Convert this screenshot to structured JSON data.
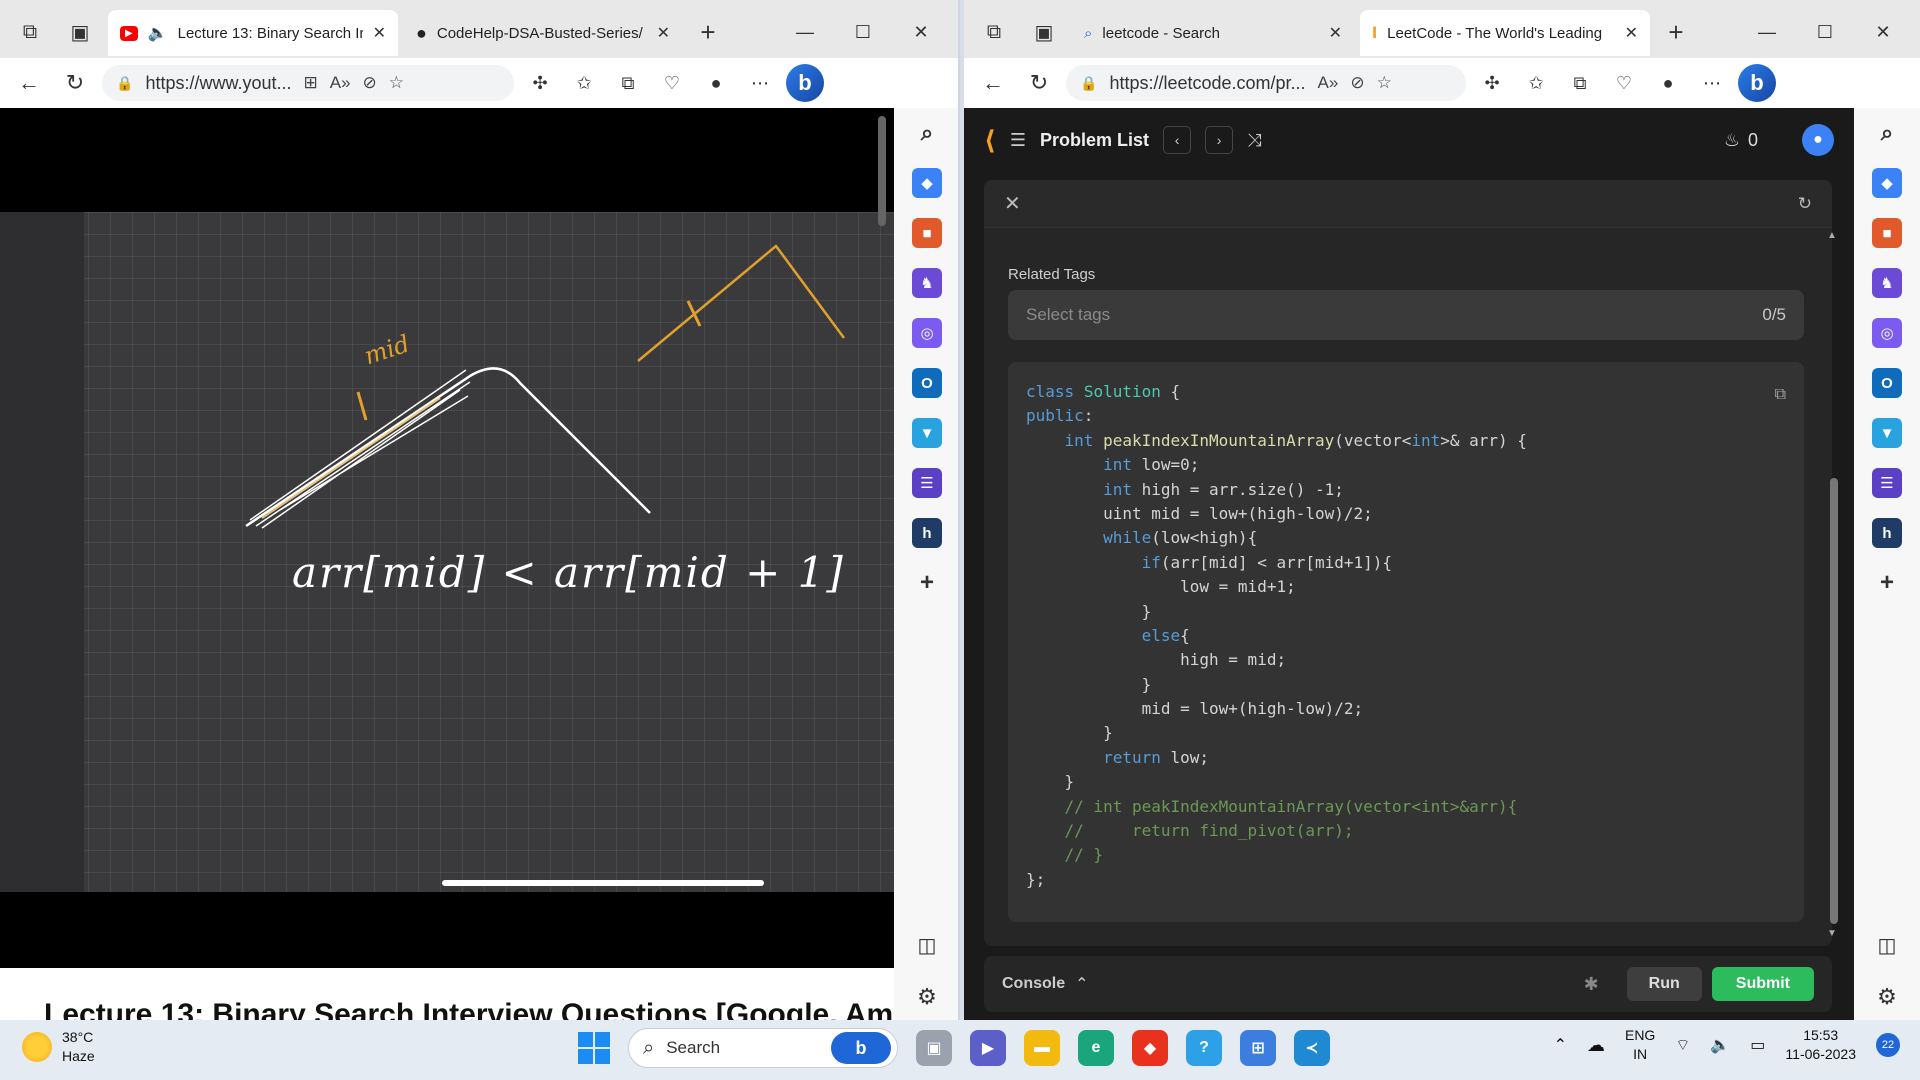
{
  "left_browser": {
    "tabs": [
      {
        "label": "Lecture 13: Binary Search Ir",
        "active": true
      },
      {
        "label": "CodeHelp-DSA-Busted-Series/",
        "active": false
      }
    ],
    "url": "https://www.yout...",
    "video": {
      "board_text": "arr[mid] < arr[mid + 1]",
      "mid_label": "mid",
      "title": "Lecture 13: Binary Search Interview Questions [Google, Am"
    }
  },
  "right_browser": {
    "tabs": [
      {
        "label": "leetcode - Search",
        "active": false
      },
      {
        "label": "LeetCode - The World's Leading",
        "active": true
      }
    ],
    "url": "https://leetcode.com/pr...",
    "leetcode": {
      "nav_title": "Problem List",
      "streak": "0",
      "related_tags_label": "Related Tags",
      "tags_placeholder": "Select tags",
      "tags_count": "0/5",
      "console_label": "Console",
      "run_label": "Run",
      "submit_label": "Submit"
    }
  },
  "taskbar": {
    "temperature": "38°C",
    "weather": "Haze",
    "search_label": "Search",
    "lang": "ENG",
    "region": "IN",
    "time": "15:53",
    "date": "11-06-2023",
    "notifications": "22"
  },
  "colors": {
    "leetcode_accent": "#f89f1b",
    "submit_green": "#2cbb5d",
    "annotation_orange": "#e0a12c"
  }
}
